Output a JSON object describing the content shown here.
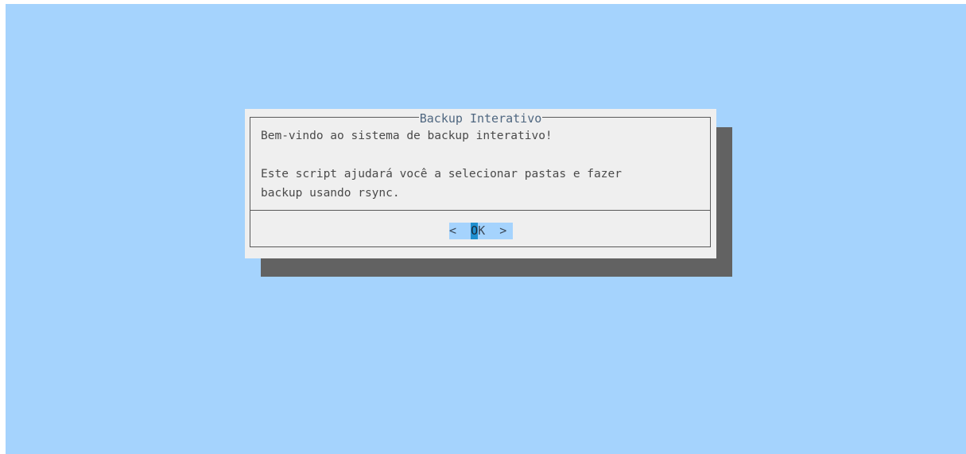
{
  "dialog": {
    "title": "Backup Interativo",
    "message_lines": [
      "Bem-vindo ao sistema de backup interativo!",
      "",
      "Este script ajudará você a selecionar pastas e fazer",
      "backup usando rsync."
    ],
    "button": {
      "left_bracket": "<",
      "hotkey": "O",
      "rest": "K",
      "right_bracket": ">"
    }
  },
  "colors": {
    "background": "#a5d3fd",
    "dialog": "#efefef",
    "shadow": "#626262",
    "title": "#4f6780",
    "hotkey": "#1f8fcf"
  }
}
